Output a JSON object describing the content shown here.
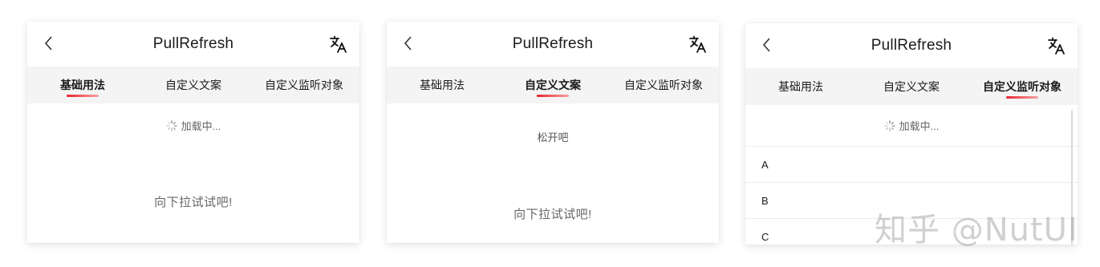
{
  "panels": [
    {
      "title": "PullRefresh",
      "tabs": [
        {
          "label": "基础用法",
          "active": true
        },
        {
          "label": "自定义文案",
          "active": false
        },
        {
          "label": "自定义监听对象",
          "active": false
        }
      ],
      "loading_text": "加载中...",
      "hint_text": "向下拉试试吧!"
    },
    {
      "title": "PullRefresh",
      "tabs": [
        {
          "label": "基础用法",
          "active": false
        },
        {
          "label": "自定义文案",
          "active": true
        },
        {
          "label": "自定义监听对象",
          "active": false
        }
      ],
      "release_text": "松开吧",
      "hint_text": "向下拉试试吧!"
    },
    {
      "title": "PullRefresh",
      "tabs": [
        {
          "label": "基础用法",
          "active": false
        },
        {
          "label": "自定义文案",
          "active": false
        },
        {
          "label": "自定义监听对象",
          "active": true
        }
      ],
      "loading_text": "加载中...",
      "list_items": [
        "A",
        "B",
        "C"
      ]
    }
  ],
  "icons": {
    "back": "chevron-left-icon",
    "language": "translate-icon",
    "spinner": "loading-spinner-icon"
  },
  "colors": {
    "tab_underline_start": "#e8242e",
    "tab_underline_end": "#f7a3a3",
    "tab_bar_bg": "#f4f4f4"
  },
  "watermark": "知乎 @NutUI"
}
